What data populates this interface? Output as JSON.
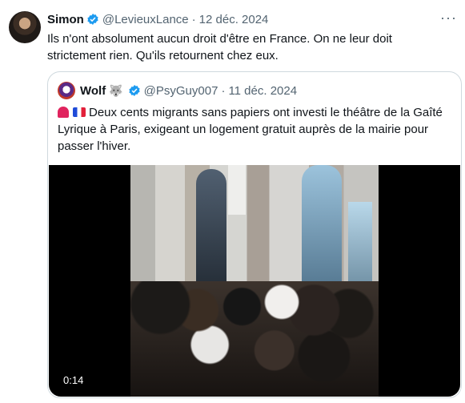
{
  "tweet": {
    "author_name": "Simon",
    "handle": "@LevieuxLance",
    "separator": "·",
    "date": "12 déc. 2024",
    "more_label": "···",
    "text": "Ils n'ont absolument aucun droit d'être en France. On ne leur doit strictement rien. Qu'ils retournent chez eux."
  },
  "quoted": {
    "author_name": "Wolf",
    "wolf_emoji": "🐺",
    "handle": "@PsyGuy007",
    "separator": "·",
    "date": "11 déc. 2024",
    "text": "Deux cents migrants sans papiers ont investi le théâtre de la Gaîté Lyrique à Paris, exigeant un logement gratuit auprès de la mairie pour passer l'hiver.",
    "video": {
      "duration": "0:14"
    }
  },
  "icons": {
    "verified": "verified-badge-icon",
    "siren": "siren-icon",
    "flag": "france-flag-icon"
  },
  "colors": {
    "verified": "#1d9bf0",
    "muted_text": "#536471",
    "border": "#cfd9de"
  }
}
